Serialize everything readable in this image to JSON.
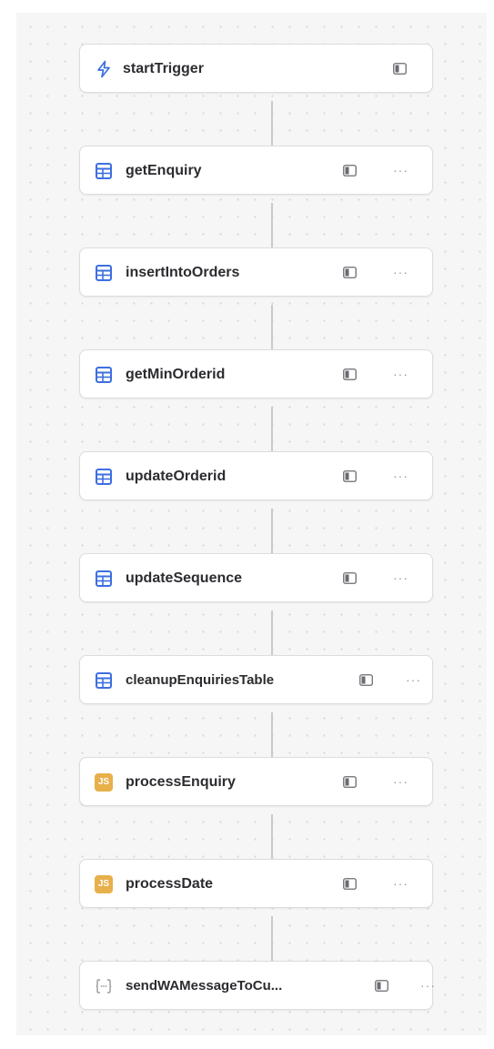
{
  "workflow": {
    "nodes": [
      {
        "label": "startTrigger",
        "icon": "lightning-icon"
      },
      {
        "label": "getEnquiry",
        "icon": "table-icon"
      },
      {
        "label": "insertIntoOrders",
        "icon": "table-icon"
      },
      {
        "label": "getMinOrderid",
        "icon": "table-icon"
      },
      {
        "label": "updateOrderid",
        "icon": "table-icon"
      },
      {
        "label": "updateSequence",
        "icon": "table-icon"
      },
      {
        "label": "cleanupEnquiriesTable",
        "icon": "table-icon"
      },
      {
        "label": "processEnquiry",
        "icon": "js-icon",
        "icon_text": "JS"
      },
      {
        "label": "processDate",
        "icon": "js-icon",
        "icon_text": "JS"
      },
      {
        "label": "sendWAMessageToCu...",
        "icon": "code-block-icon"
      }
    ]
  },
  "colors": {
    "table_icon": "#3d6fe0",
    "trigger_icon": "#3d6fe0",
    "js_icon": "#e7b04a",
    "code_icon": "#9a9aa0"
  }
}
